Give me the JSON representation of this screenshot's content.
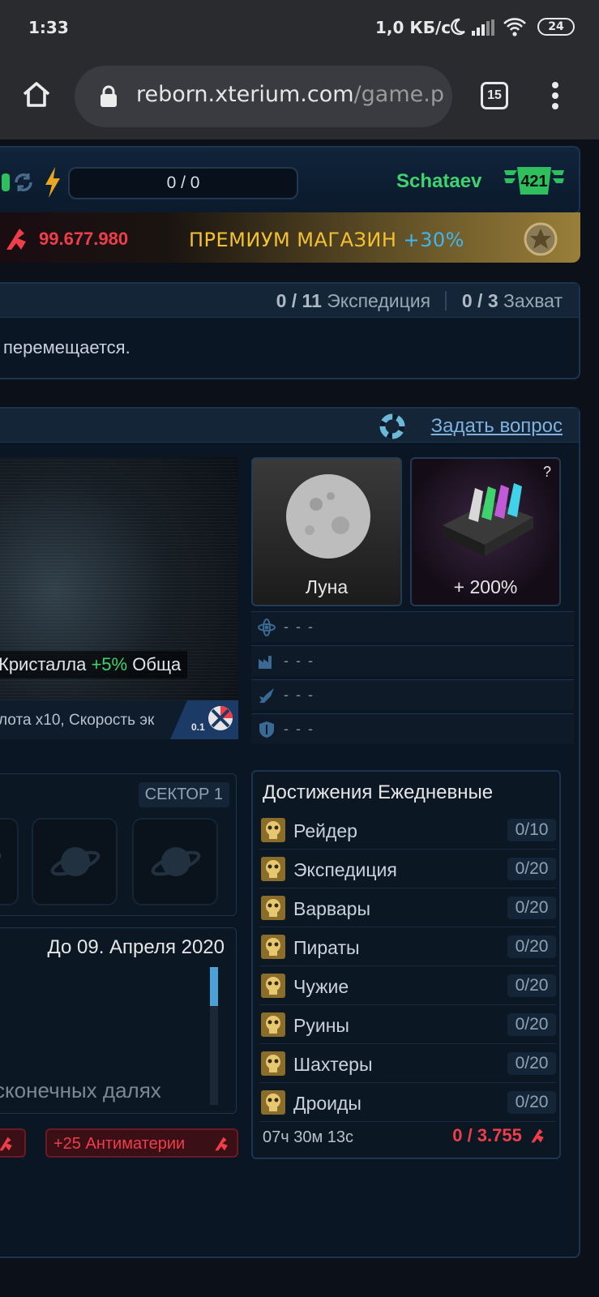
{
  "status": {
    "time": "1:33",
    "network": "1,0 КБ/с",
    "battery": "24"
  },
  "browser": {
    "url_main": "reborn.xterium.com",
    "url_path": "/game.p",
    "tab_count": "15"
  },
  "game": {
    "energy": "0 / 0",
    "username": "Schataev",
    "level": "421",
    "antimatter": "99.677.980",
    "premium_label": "ПРЕМИУМ МАГАЗИН",
    "premium_bonus": "+30%",
    "fleet": {
      "expedition_count": "0 / 11",
      "expedition_label": "Экспедиция",
      "capture_count": "0 / 3",
      "capture_label": "Захват",
      "message": "перемещается."
    },
    "ask_question": "Задать вопрос",
    "planet": {
      "bonus_prefix": "Кристалла",
      "bonus_value": "+5%",
      "bonus_suffix": "Обща",
      "speed_text": "лота х10, Скорость эк",
      "speed_badge": "0.1"
    },
    "moon_label": "Луна",
    "boost_label": "+ 200%",
    "boost_help": "?",
    "stats": [
      "- - -",
      "- - -",
      "- - -",
      "- - -"
    ],
    "sector_label": "СЕКТОР 1",
    "event": {
      "date": "До 09. Апреля 2020",
      "text": "сконечных далях"
    },
    "reward_label": "+25 Антиматерии",
    "achievements": {
      "title": "Достижения Ежедневные",
      "items": [
        {
          "name": "Рейдер",
          "count": "0/10"
        },
        {
          "name": "Экспедиция",
          "count": "0/20"
        },
        {
          "name": "Варвары",
          "count": "0/20"
        },
        {
          "name": "Пираты",
          "count": "0/20"
        },
        {
          "name": "Чужие",
          "count": "0/20"
        },
        {
          "name": "Руины",
          "count": "0/20"
        },
        {
          "name": "Шахтеры",
          "count": "0/20"
        },
        {
          "name": "Дроиды",
          "count": "0/20"
        }
      ],
      "timer": "07ч 30м 13с",
      "points": "0 / 3.755"
    }
  }
}
